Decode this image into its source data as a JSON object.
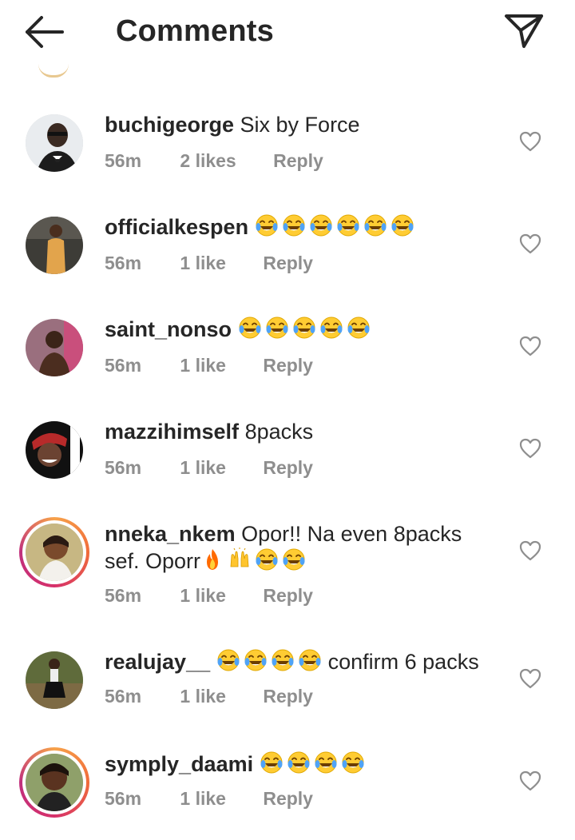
{
  "header": {
    "title": "Comments",
    "back_icon": "arrow-left-icon",
    "send_icon": "paper-plane-icon"
  },
  "comments": [
    {
      "username": "buchigeorge",
      "text": "Six by Force",
      "emojis": [],
      "time": "56m",
      "likes": "2 likes",
      "reply": "Reply",
      "story": false
    },
    {
      "username": "officialkespen",
      "text": "",
      "emojis": [
        "joy",
        "joy",
        "joy",
        "joy",
        "joy",
        "joy"
      ],
      "time": "56m",
      "likes": "1 like",
      "reply": "Reply",
      "story": false
    },
    {
      "username": "saint_nonso",
      "text": "",
      "emojis": [
        "joy",
        "joy",
        "joy",
        "joy",
        "joy"
      ],
      "time": "56m",
      "likes": "1 like",
      "reply": "Reply",
      "story": false
    },
    {
      "username": "mazzihimself",
      "text": "8packs",
      "emojis": [],
      "time": "56m",
      "likes": "1 like",
      "reply": "Reply",
      "story": false
    },
    {
      "username": "nneka_nkem",
      "text_line1": "Opor!! Na even 8packs",
      "text_line2": "sef. Oporr",
      "emojis": [
        "fire",
        "raised-hands",
        "joy",
        "joy"
      ],
      "time": "56m",
      "likes": "1 like",
      "reply": "Reply",
      "story": true
    },
    {
      "username": "realujay__",
      "text": "confirm 6 packs",
      "emojis": [
        "joy",
        "joy",
        "joy",
        "joy"
      ],
      "time": "56m",
      "likes": "1 like",
      "reply": "Reply",
      "story": false
    },
    {
      "username": "symply_daami",
      "text": "",
      "emojis": [
        "joy",
        "joy",
        "joy",
        "joy"
      ],
      "time": "56m",
      "likes": "1 like",
      "reply": "Reply",
      "story": true
    }
  ],
  "colors": {
    "text": "#262626",
    "muted": "#8e8e8e",
    "story_ring_start": "#f7a24a",
    "story_ring_end": "#c0307d"
  }
}
